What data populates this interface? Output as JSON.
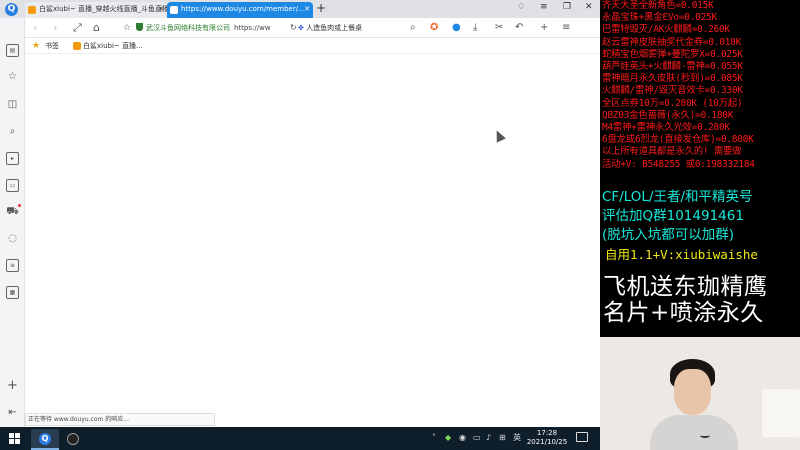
{
  "browser": {
    "tabs": [
      {
        "label": "白鲨xiubi~ 直播_穿越火线直播_斗鱼直播",
        "active": false
      },
      {
        "label": "https://www.douyu.com/member/…",
        "active": true
      }
    ],
    "address": {
      "secure_label": "武汉斗鱼网络科技有限公司",
      "url": "https://ww",
      "search_text": "人造鱼肉或上餐桌"
    },
    "bookmarks": {
      "label": "书签",
      "items": [
        "白鲨xiubi~ 直播..."
      ]
    },
    "status_text": "正在等待 www.douyu.com 的响应..."
  },
  "taskbar": {
    "ime_label": "英",
    "time": "17:28",
    "date": "2021/10/25"
  },
  "overlay": {
    "promo_lines": [
      "齐天大圣全新角色=0.015K",
      "永晶宝珠+黑金EVo=0.025K",
      "巴雷特毁灭/AK火麒麟=0.260K",
      "赵云雷神皮肤抽奖代金券=0.010K",
      "蛇精宝色烟雾弹+曼陀罗X=0.025K",
      "葫芦娃英头+火麒麟-雷神=0.055K",
      "雷神暗月永久皮肤(秒到)=0.085K",
      "火麒麟/雷神/毁灭音效卡=0.330K",
      "全区点券10万=0.280K (10万起)",
      "QBZ03金色蔷薇(永久)=0.180K",
      "M4雷神+雷神永久光效=0.280K",
      "6盘龙或6烈龙(直接发仓库)=0.800K",
      "以上所有道具都是永久的! 需要做",
      "活动+V: B548255  或0:198332184"
    ],
    "ad_lines": [
      "CF/LOL/王者/和平精英号",
      "评估加Q群101491461",
      "(脱坑入坑都可以加群)"
    ],
    "self_use": "自用1.1+V:xiubiwaishe",
    "big_lines": [
      "飞机送东珈精鹰",
      "名片+喷涂永久"
    ]
  },
  "colors": {
    "tab_active": "#1e88e5",
    "promo_red": "#ff1a1a",
    "ad_cyan": "#17e8d9",
    "ad_yellow": "#f0e914",
    "taskbar": "#0f1e2b"
  }
}
